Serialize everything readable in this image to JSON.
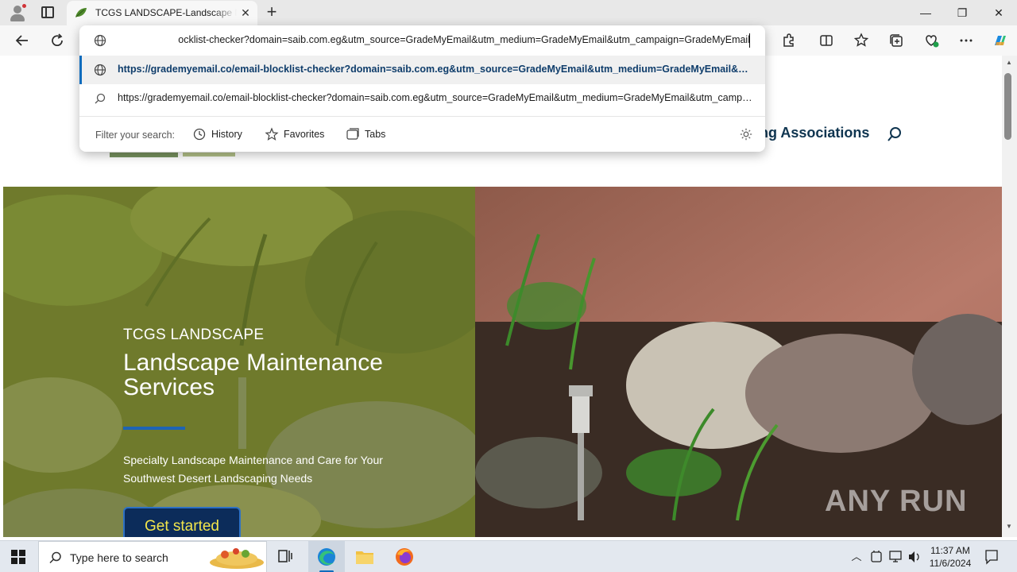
{
  "browser": {
    "tab": {
      "title": "TCGS LANDSCAPE-Landscape Maintenance Services"
    },
    "window_controls": {
      "minimize": "—",
      "restore": "❐",
      "close": "✕"
    }
  },
  "omnibox": {
    "input_value": "ocklist-checker?domain=saib.com.eg&utm_source=GradeMyEmail&utm_medium=GradeMyEmail&utm_campaign=GradeMyEmail",
    "suggestions": [
      {
        "text": "https://grademyemail.co/email-blocklist-checker?domain=saib.com.eg&utm_source=GradeMyEmail&utm_medium=GradeMyEmail&utm_campaign=GradeMyEmail",
        "icon": "globe-icon",
        "highlighted": true
      },
      {
        "text": "https://grademyemail.co/email-blocklist-checker?domain=saib.com.eg&utm_source=GradeMyEmail&utm_medium=GradeMyEmail&utm_campaign=GradeMyEmail",
        "icon": "search-icon",
        "highlighted": false
      }
    ],
    "filter": {
      "label": "Filter your search:",
      "chips": [
        "History",
        "Favorites",
        "Tabs"
      ]
    }
  },
  "site": {
    "nav_partial": "ng Associations",
    "hero": {
      "eyebrow": "TCGS LANDSCAPE",
      "title": "Landscape Maintenance Services",
      "description": "Specialty Landscape Maintenance and Care for Your Southwest Desert Landscaping Needs",
      "cta": "Get started"
    }
  },
  "watermark": "ANY RUN",
  "taskbar": {
    "search_placeholder": "Type here to search",
    "clock_time": "11:37 AM",
    "clock_date": "11/6/2024"
  },
  "colors": {
    "hero_overlay": "#6f7a2c",
    "cta_background": "#0c2c5a",
    "cta_text": "#f2e54b",
    "divider_accent": "#1e64b4",
    "nav_text": "#0f3550"
  }
}
